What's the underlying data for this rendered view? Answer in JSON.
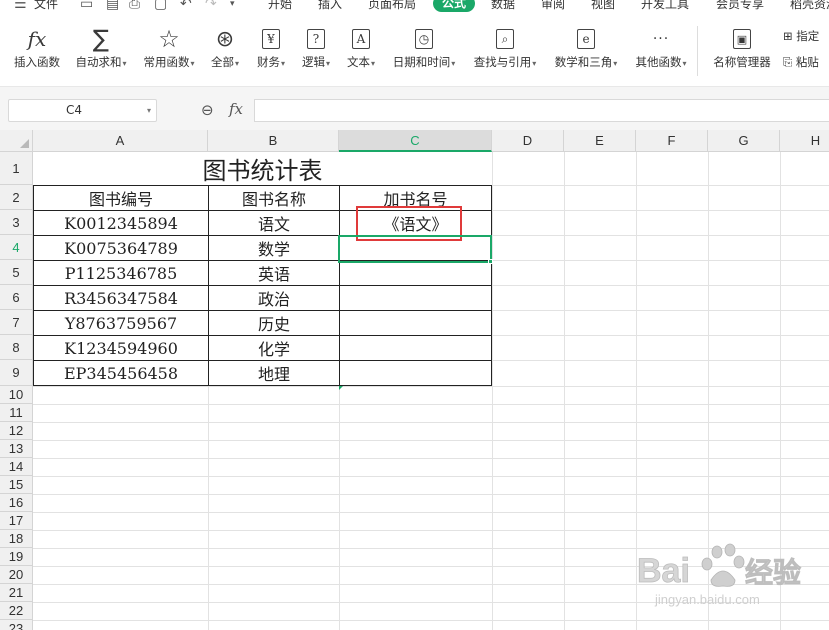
{
  "menubar": {
    "file": "文件",
    "tabs": [
      {
        "label": "开始",
        "active": false
      },
      {
        "label": "插入",
        "active": false
      },
      {
        "label": "页面布局",
        "active": false
      },
      {
        "label": "公式",
        "active": true
      },
      {
        "label": "数据",
        "active": false
      },
      {
        "label": "审阅",
        "active": false
      },
      {
        "label": "视图",
        "active": false
      },
      {
        "label": "开发工具",
        "active": false
      },
      {
        "label": "会员专享",
        "active": false
      },
      {
        "label": "稻壳资源",
        "active": false
      }
    ]
  },
  "ribbon": {
    "insert_function": "插入函数",
    "autosum": "自动求和",
    "common_functions": "常用函数",
    "all": "全部",
    "finance": "财务",
    "logic": "逻辑",
    "text": "文本",
    "datetime": "日期和时间",
    "lookup": "查找与引用",
    "math": "数学和三角",
    "other": "其他函数",
    "name_manager": "名称管理器",
    "specify": "指定",
    "paste": "粘贴",
    "icons": {
      "finance_glyph": "¥",
      "logic_glyph": "?",
      "text_glyph": "A",
      "math_glyph": "e",
      "other_glyph": "···"
    }
  },
  "formula_bar": {
    "name_box": "C4",
    "fx": "fx",
    "formula": ""
  },
  "sheet": {
    "columns": [
      "A",
      "B",
      "C",
      "D",
      "E",
      "F",
      "G",
      "H"
    ],
    "rows": [
      "1",
      "2",
      "3",
      "4",
      "5",
      "6",
      "7",
      "8",
      "9",
      "10",
      "11",
      "12",
      "13",
      "14",
      "15",
      "16",
      "17",
      "18",
      "19",
      "20",
      "21",
      "22",
      "23"
    ],
    "selected_column": "C",
    "selected_row": "4",
    "title": "图书统计表",
    "headers": [
      "图书编号",
      "图书名称",
      "加书名号"
    ],
    "data": [
      {
        "id": "K0012345894",
        "name": "语文",
        "quoted": "《语文》"
      },
      {
        "id": "K0075364789",
        "name": "数学",
        "quoted": ""
      },
      {
        "id": "P1125346785",
        "name": "英语",
        "quoted": ""
      },
      {
        "id": "R3456347584",
        "name": "政治",
        "quoted": ""
      },
      {
        "id": "Y8763759567",
        "name": "历史",
        "quoted": ""
      },
      {
        "id": "K1234594960",
        "name": "化学",
        "quoted": ""
      },
      {
        "id": "EP345456458",
        "name": "地理",
        "quoted": ""
      }
    ]
  },
  "colors": {
    "accent": "#1aa868",
    "highlight": "#e03a3a"
  },
  "watermark": {
    "brand": "Bai",
    "brand_cn": "经验",
    "url": "jingyan.baidu.com"
  }
}
